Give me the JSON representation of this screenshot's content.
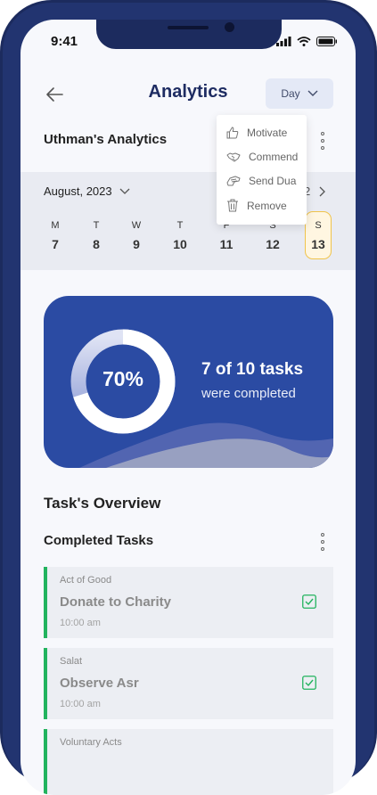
{
  "status": {
    "time": "9:41"
  },
  "header": {
    "title": "Analytics",
    "range_label": "Day"
  },
  "analytics": {
    "title": "Uthman's Analytics"
  },
  "menu": {
    "items": [
      {
        "label": "Motivate",
        "icon": "thumbs-up-icon"
      },
      {
        "label": "Commend",
        "icon": "handshake-icon"
      },
      {
        "label": "Send Dua",
        "icon": "praying-hands-icon"
      },
      {
        "label": "Remove",
        "icon": "trash-icon"
      }
    ]
  },
  "calendar": {
    "month": "August, 2023",
    "next_hint": "2",
    "days": [
      {
        "name": "M",
        "date": "7"
      },
      {
        "name": "T",
        "date": "8"
      },
      {
        "name": "W",
        "date": "9"
      },
      {
        "name": "T",
        "date": "10"
      },
      {
        "name": "F",
        "date": "11"
      },
      {
        "name": "S",
        "date": "12"
      },
      {
        "name": "S",
        "date": "13"
      }
    ],
    "selected_index": 6
  },
  "progress": {
    "percent_label": "70%",
    "percent": 70,
    "tasks_label": "7 of 10 tasks",
    "subtitle": "were completed"
  },
  "overview": {
    "title": "Task's Overview",
    "completed_title": "Completed Tasks"
  },
  "tasks": [
    {
      "category": "Act of Good",
      "name": "Donate to Charity",
      "time": "10:00 am"
    },
    {
      "category": "Salat",
      "name": "Observe Asr",
      "time": "10:00 am"
    },
    {
      "category": "Voluntary Acts",
      "name": "",
      "time": ""
    }
  ],
  "colors": {
    "accent": "#2b4ba3",
    "check": "#22b35e",
    "selected_day": "#f0c44c"
  }
}
